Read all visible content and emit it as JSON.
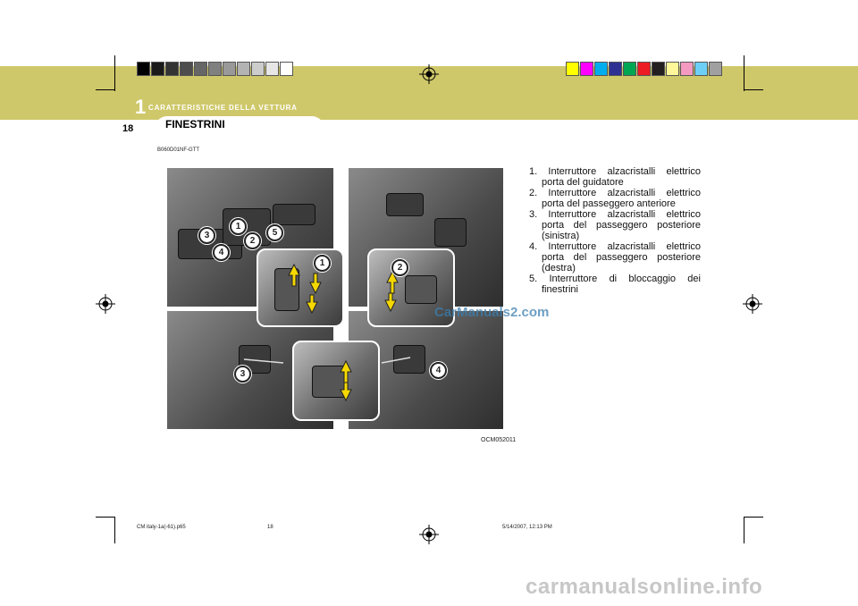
{
  "header": {
    "chapter_number": "1",
    "chapter_title": "CARATTERISTICHE DELLA VETTURA",
    "page_number": "18",
    "section_title": "FINESTRINI",
    "band_color": "#cfc86a"
  },
  "reference_code": "B060D01NF-GTT",
  "figure": {
    "caption_code": "OCM052011",
    "callouts": [
      "1",
      "2",
      "3",
      "4",
      "5"
    ]
  },
  "items": [
    "1. Interruttore alzacristalli elettrico porta del guidatore",
    "2. Interruttore alzacristalli elettrico porta del passeggero anteriore",
    "3. Interruttore alzacristalli elettrico porta del passeggero posteriore (sinistra)",
    "4. Interruttore alzacristalli elettrico porta del passeggero posteriore (destra)",
    "5. Interruttore di bloccaggio dei finestrini"
  ],
  "watermark": "CarManuals2.com",
  "footer": {
    "file": "CM italy-1a(-61).p65",
    "page": "18",
    "timestamp": "5/14/2007, 12:13 PM"
  },
  "site_watermark": "carmanualsonline.info",
  "color_bar_gray": [
    "#000000",
    "#1a1a1a",
    "#333333",
    "#4d4d4d",
    "#666666",
    "#808080",
    "#999999",
    "#b3b3b3",
    "#cccccc",
    "#e6e6e6",
    "#ffffff"
  ],
  "color_bar_color": [
    "#ffff00",
    "#ff00ff",
    "#00aeef",
    "#2e3192",
    "#00a651",
    "#ed1c24",
    "#231f20",
    "#fff799",
    "#f49ac1",
    "#6dcff6",
    "#a0a0a0"
  ]
}
